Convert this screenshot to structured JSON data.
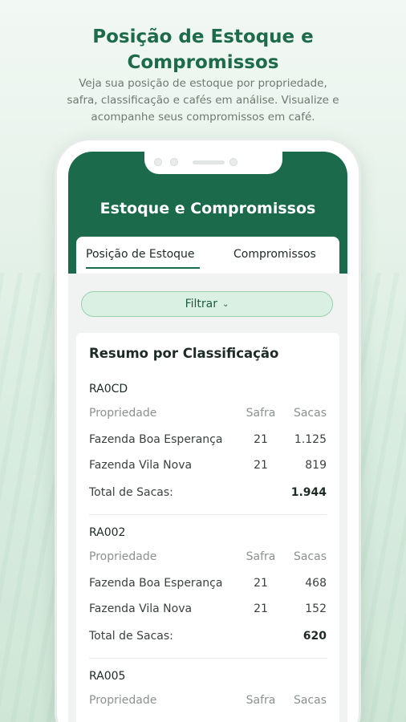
{
  "promo": {
    "title_line1": "Posição de Estoque e",
    "title_line2": "Compromissos",
    "subtitle_line1": "Veja sua posição de estoque  por propriedade,",
    "subtitle_line2": "safra, classificação e cafés em análise. Visualize e",
    "subtitle_line3": "acompanhe seus compromissos em café."
  },
  "app": {
    "title": "Estoque e Compromissos",
    "tabs": [
      {
        "label": "Posição de Estoque",
        "active": true
      },
      {
        "label": "Compromissos",
        "active": false
      }
    ],
    "filter_label": "Filtrar",
    "filter_icon": "chevron-down-icon",
    "card_title": "Resumo por Classificação",
    "columns": {
      "propriedade": "Propriedade",
      "safra": "Safra",
      "sacas": "Sacas"
    },
    "total_label": "Total de Sacas:",
    "sections": [
      {
        "code": "RA0CD",
        "rows": [
          {
            "propriedade": "Fazenda Boa Esperança",
            "safra": "21",
            "sacas": "1.125"
          },
          {
            "propriedade": "Fazenda Vila Nova",
            "safra": "21",
            "sacas": "819"
          }
        ],
        "total": "1.944"
      },
      {
        "code": "RA002",
        "rows": [
          {
            "propriedade": "Fazenda Boa Esperança",
            "safra": "21",
            "sacas": "468"
          },
          {
            "propriedade": "Fazenda Vila Nova",
            "safra": "21",
            "sacas": "152"
          }
        ],
        "total": "620"
      },
      {
        "code": "RA005",
        "rows": [],
        "total": ""
      }
    ]
  },
  "colors": {
    "brand_green": "#1b6a4c",
    "filter_bg": "#d9f0e2",
    "title_green": "#1d6b4a"
  }
}
